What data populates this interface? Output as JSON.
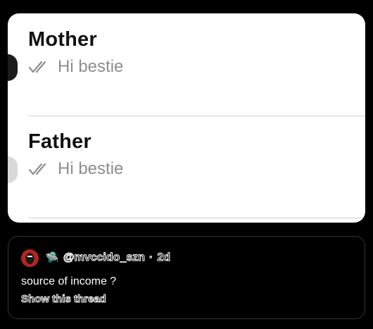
{
  "chats": [
    {
      "name": "Mother",
      "preview": "Hi bestie"
    },
    {
      "name": "Father",
      "preview": "Hi bestie"
    }
  ],
  "tweet": {
    "emoji": "🛸",
    "handle": "@mvccido_szn",
    "separator": "·",
    "time": "2d",
    "text": "source of income ?",
    "show_thread": "Show this thread"
  },
  "colors": {
    "card_bg": "#ffffff",
    "name_text": "#111111",
    "preview_text": "#8e8e8e",
    "tweet_bg": "#000000",
    "avatar": "#b3251e"
  }
}
